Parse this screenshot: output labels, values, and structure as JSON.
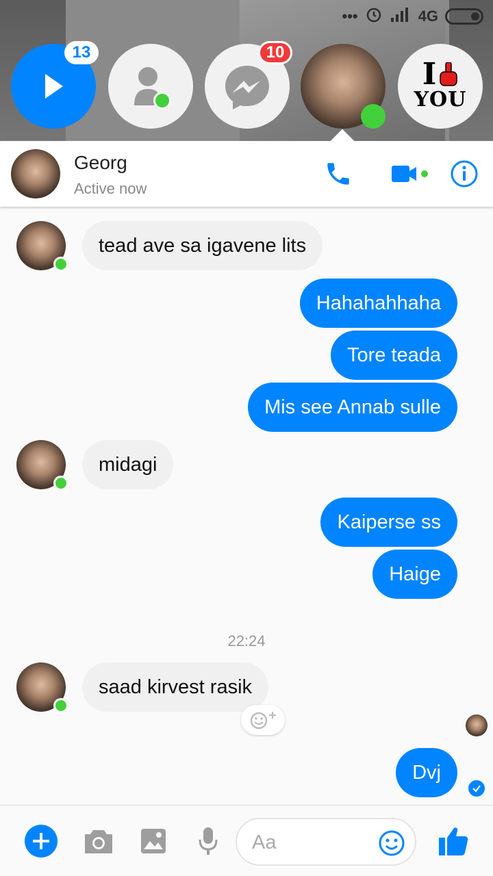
{
  "status_bar": {
    "network": "4G"
  },
  "chat_heads": {
    "main_badge": "13",
    "messenger_badge": "10",
    "sticker_top": "I",
    "sticker_bottom": "YOU"
  },
  "conversation": {
    "contact_name": "Georg",
    "contact_status": "Active now",
    "accent_color": "#0084ff",
    "online_color": "#42d13b",
    "messages": [
      {
        "from": "them",
        "text": "tead ave sa igavene lits"
      },
      {
        "from": "me",
        "text": "Hahahahhaha"
      },
      {
        "from": "me",
        "text": "Tore teada"
      },
      {
        "from": "me",
        "text": "Mis see Annab sulle"
      },
      {
        "from": "them",
        "text": "midagi"
      },
      {
        "from": "me",
        "text": "Kaiperse ss"
      },
      {
        "from": "me",
        "text": "Haige"
      },
      {
        "from": "them",
        "text": "saad kirvest rasik"
      },
      {
        "from": "me",
        "text": "Dvj"
      }
    ],
    "timestamp": "22:24"
  },
  "composer": {
    "placeholder": "Aa"
  }
}
